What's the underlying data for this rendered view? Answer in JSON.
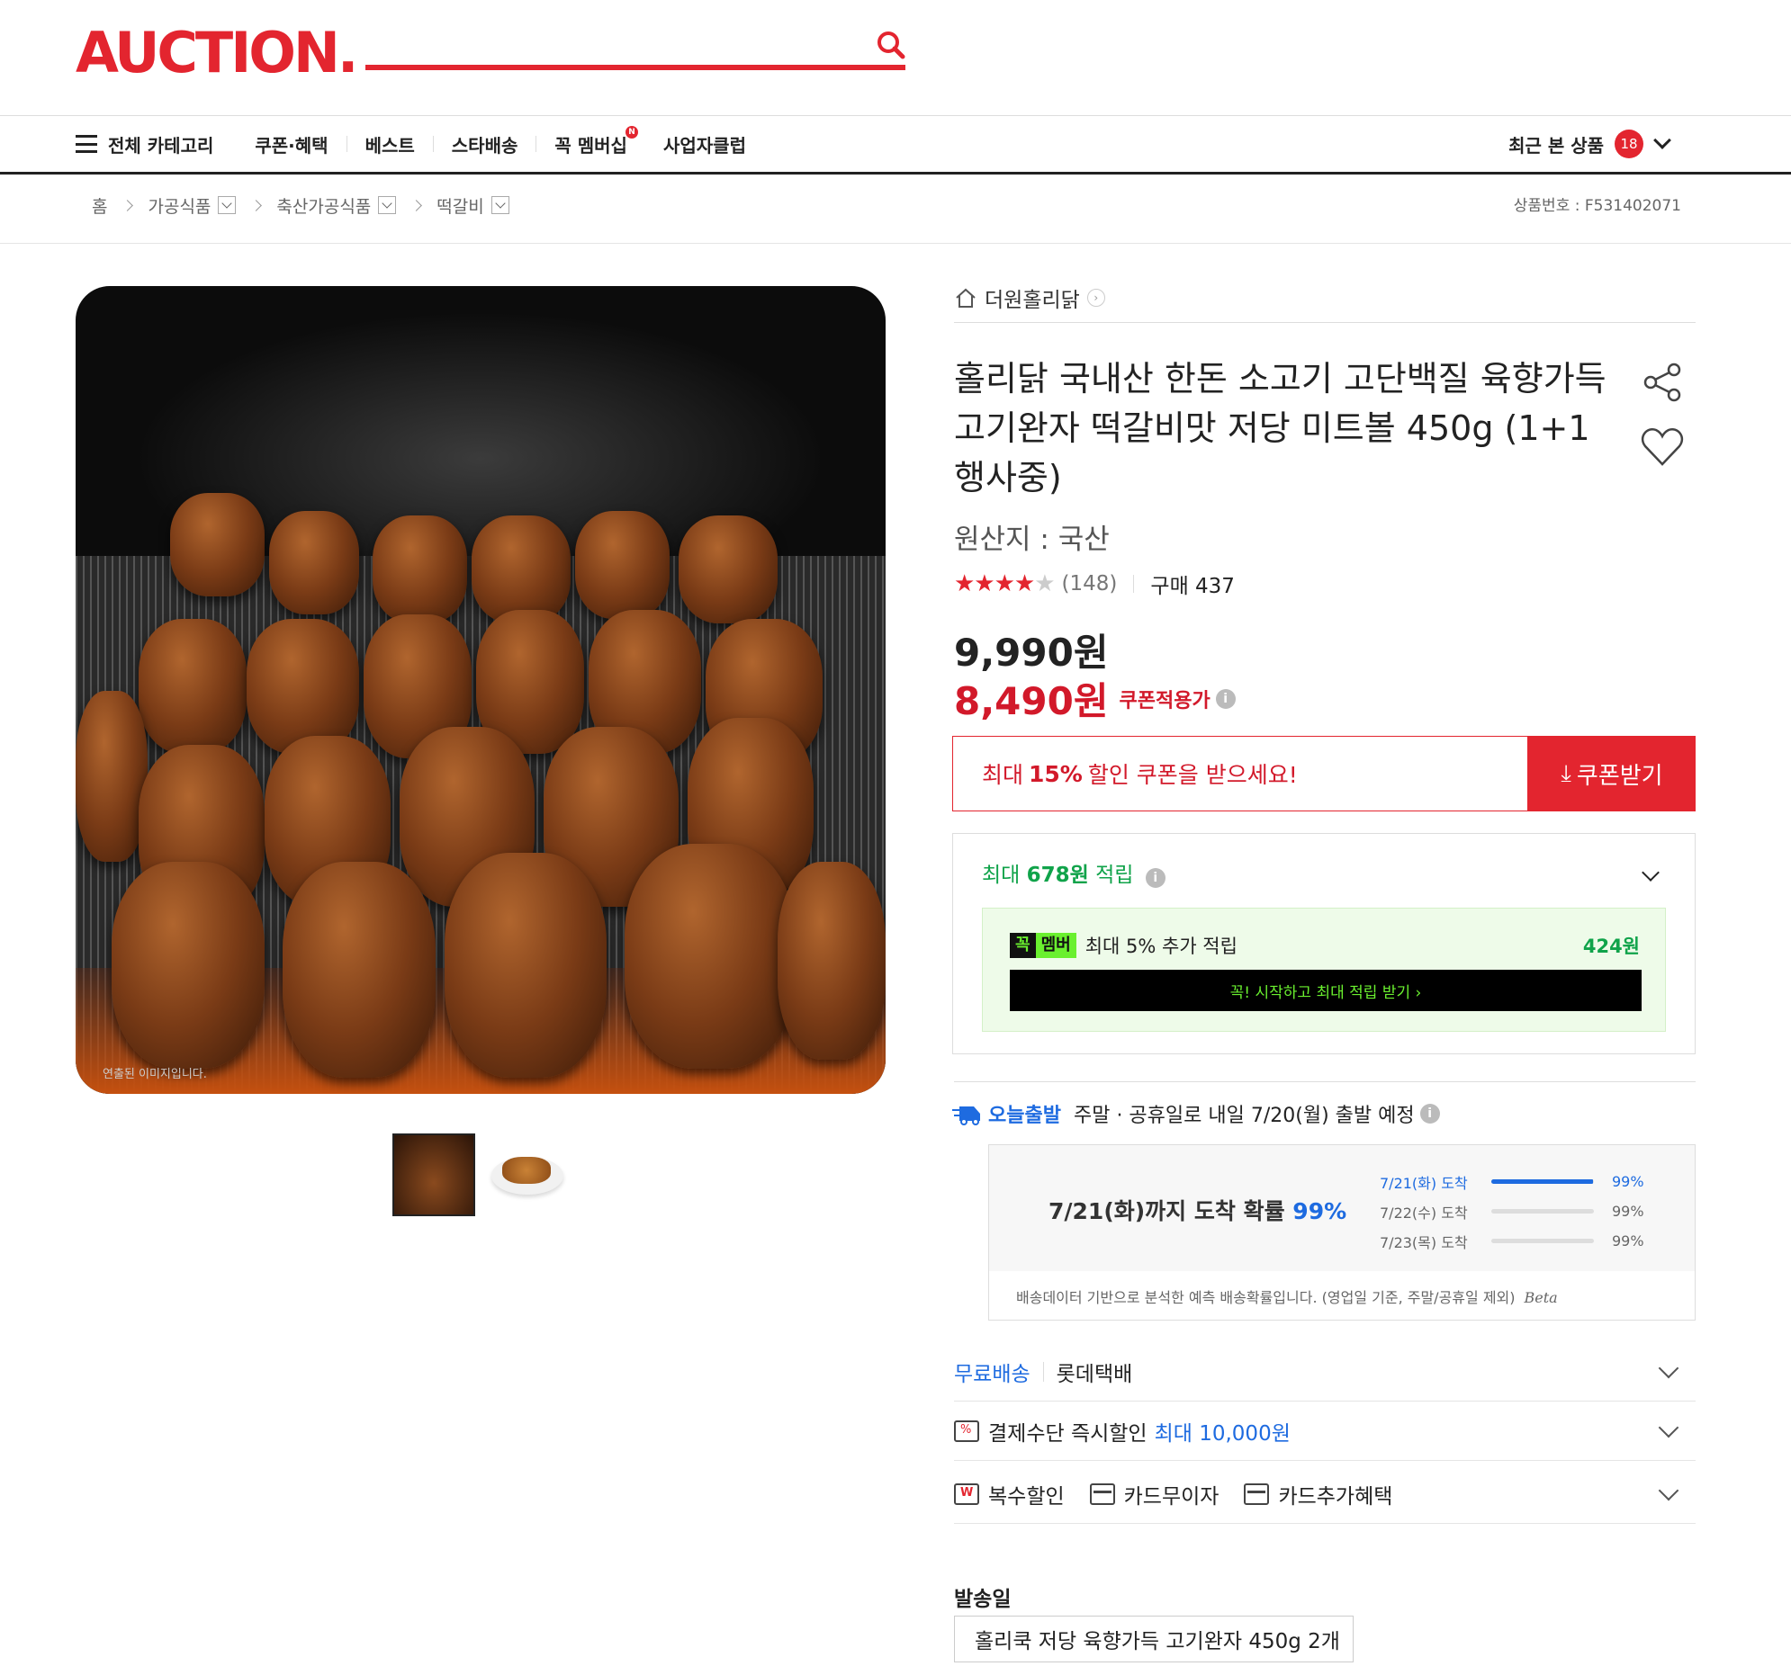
{
  "header": {
    "logo": "AUCTION.",
    "search_placeholder": ""
  },
  "nav": {
    "all_categories": "전체 카테고리",
    "items": [
      "쿠폰·혜택",
      "베스트",
      "스타배송",
      "꼭 멤버십",
      "사업자클럽"
    ],
    "membership_dot": "N",
    "recent_label": "최근 본 상품",
    "recent_count": "18"
  },
  "breadcrumb": {
    "home": "홈",
    "levels": [
      "가공식품",
      "축산가공식품",
      "떡갈비"
    ],
    "product_no": "상품번호 : F531402071"
  },
  "gallery": {
    "caption": "연출된 이미지입니다."
  },
  "product": {
    "store": "더원홀리닭",
    "title": "홀리닭 국내산 한돈 소고기 고단백질 육향가득 고기완자 떡갈비맛 저당 미트볼 450g (1+1행사중)",
    "origin": "원산지 : 국산",
    "stars": "★★★★",
    "rating_value": 4.5,
    "review_count": "(148)",
    "purchase": "구매 437",
    "price": "9,990원",
    "sale_price": "8,490원",
    "sale_label": "쿠폰적용가"
  },
  "coupon": {
    "prefix": "최대",
    "percent": "15%",
    "suffix": "할인 쿠폰을 받으세요!",
    "button": "쿠폰받기"
  },
  "points": {
    "prefix": "최대",
    "amount": "678원",
    "suffix": "적립",
    "member_badge_a": "꼭",
    "member_badge_b": "멤버",
    "member_text": "최대 5% 추가 적립",
    "member_amount": "424원",
    "member_button": "꼭! 시작하고 최대 적립 받기 ›"
  },
  "shipping": {
    "today_label": "오늘출발",
    "text": "주말 · 공휴일로 내일 7/20(월) 출발 예정",
    "prob_main": "7/21(화)까지 도착 확률",
    "prob_pct": "99%",
    "rows": [
      {
        "date": "7/21(화) 도착",
        "value": "99%",
        "fill": 0.99
      },
      {
        "date": "7/22(수) 도착",
        "value": "99%",
        "fill": 0
      },
      {
        "date": "7/23(목) 도착",
        "value": "99%",
        "fill": 0
      }
    ],
    "note": "배송데이터 기반으로 분석한 예측 배송확률입니다. (영업일 기준, 주말/공휴일 제외)",
    "beta": "Beta"
  },
  "options": {
    "free_ship": "무료배송",
    "carrier": "롯데택배",
    "pay_discount": "결제수단 즉시할인",
    "pay_discount_max": "최대 10,000원",
    "multi_discount": "복수할인",
    "card_installment": "카드무이자",
    "card_benefit": "카드추가혜택"
  },
  "ship_date": {
    "label": "발송일",
    "value": "홀리쿡 저당 육향가득 고기완자 450g 2개"
  }
}
